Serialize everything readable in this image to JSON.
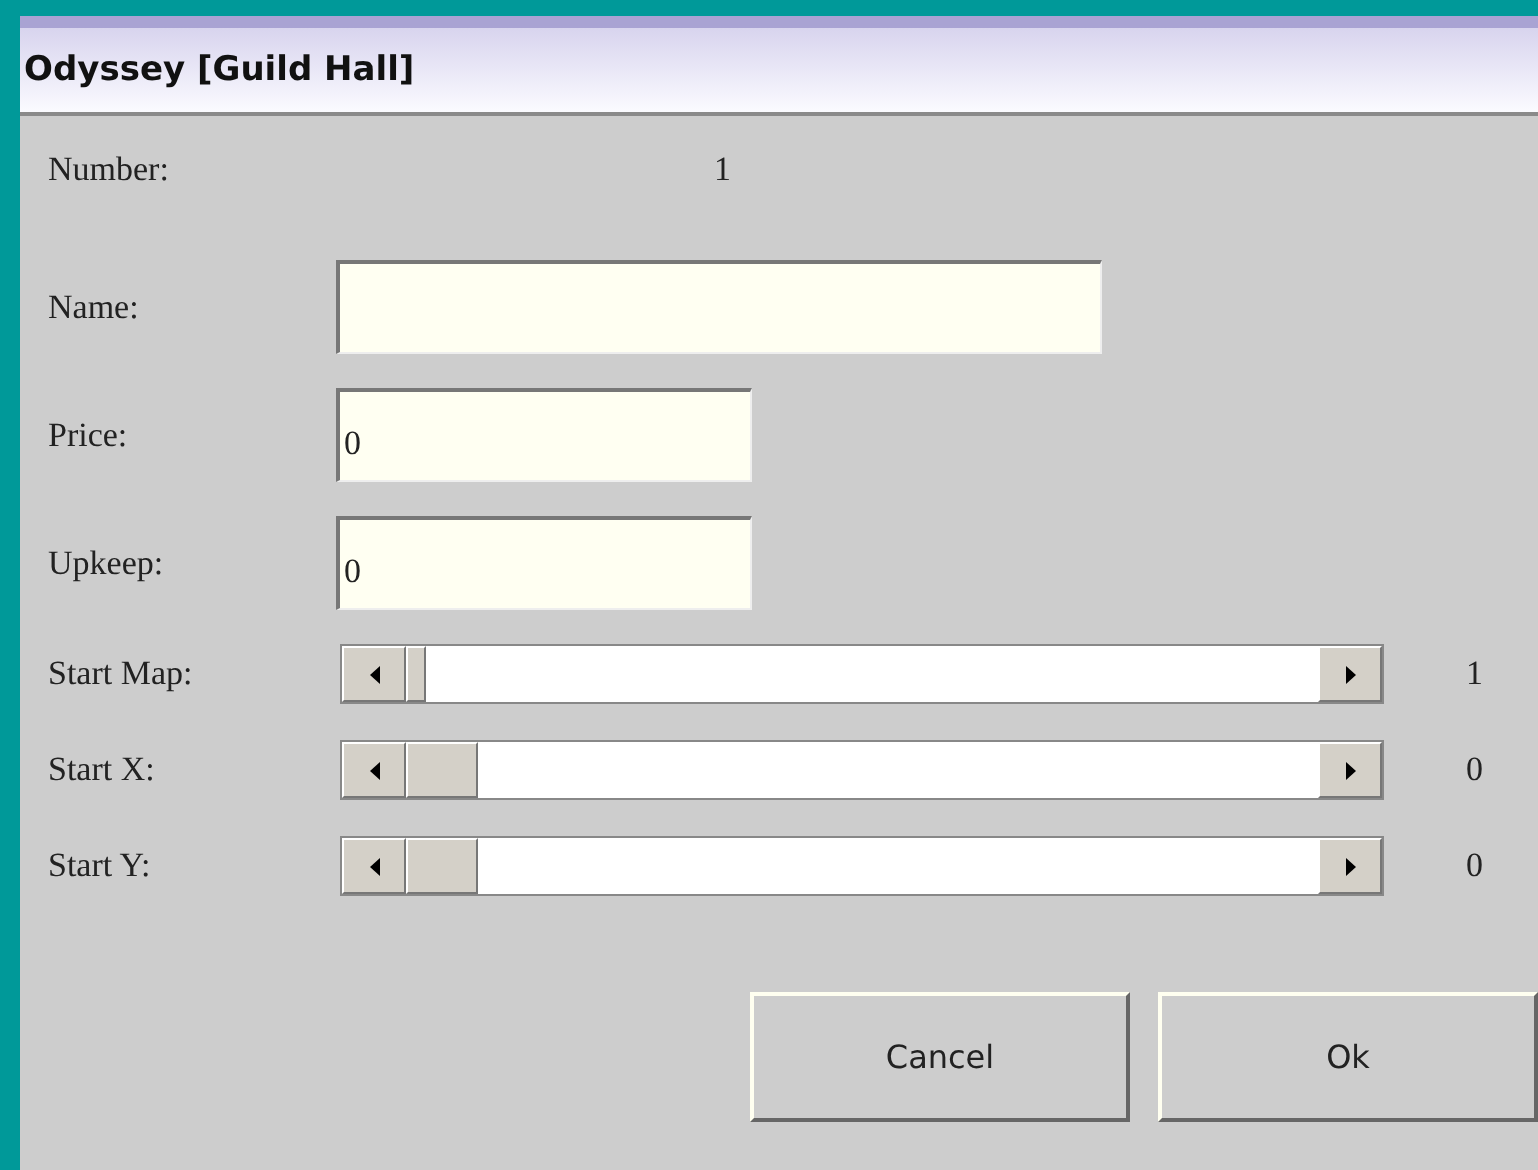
{
  "window": {
    "title": "Odyssey [Guild Hall]"
  },
  "number": {
    "label": "Number:",
    "value": "1"
  },
  "fields": [
    {
      "label": "Name:",
      "kind": "wide"
    },
    {
      "label": "Price:",
      "value": "0",
      "kind": "narrow"
    },
    {
      "label": "Upkeep:",
      "value": "0",
      "kind": "narrow"
    }
  ],
  "sliders": [
    {
      "label": "Start Map:",
      "level": 0,
      "reading": "1",
      "kind": "fine"
    },
    {
      "label": "Start X:",
      "level": 0,
      "reading": "0",
      "kind": "coarse"
    },
    {
      "label": "Start Y:",
      "level": 0,
      "reading": "0",
      "kind": "coarse"
    }
  ],
  "buttons": [
    "Cancel",
    "Ok"
  ]
}
